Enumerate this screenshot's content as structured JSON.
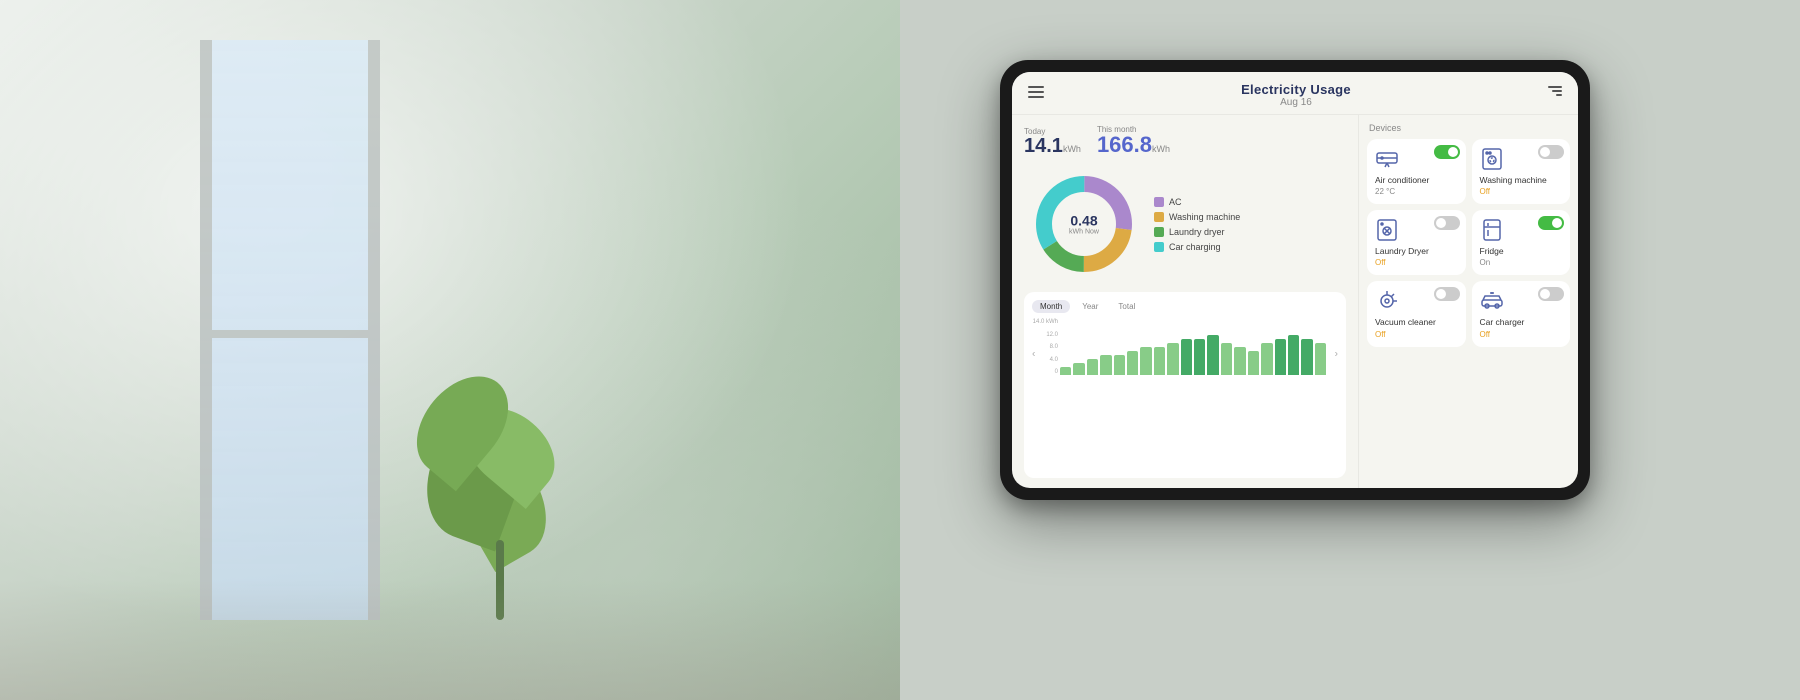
{
  "header": {
    "title": "Electricity Usage",
    "date": "Aug 16",
    "menu_icon": "menu",
    "filter_icon": "filter"
  },
  "stats": {
    "today_label": "Today",
    "today_value": "14.1",
    "today_unit": "kWh",
    "month_label": "This month",
    "month_value": "166.8",
    "month_unit": "kWh"
  },
  "donut": {
    "center_value": "0.48",
    "center_sub": "kWh Now",
    "segments": [
      {
        "label": "AC",
        "color": "#aa88cc",
        "pct": 27
      },
      {
        "label": "Washing machine",
        "color": "#ddaa44",
        "pct": 23
      },
      {
        "label": "Laundry dryer",
        "color": "#55aa55",
        "pct": 16
      },
      {
        "label": "Car charging",
        "color": "#44cccc",
        "pct": 34
      }
    ]
  },
  "bar_chart": {
    "tabs": [
      "Month",
      "Year",
      "Total"
    ],
    "active_tab": "Month",
    "y_labels": [
      "14.0 kWh",
      "12.0",
      "8.0",
      "4.0",
      "0"
    ],
    "bars": [
      2,
      3,
      4,
      5,
      5,
      6,
      7,
      7,
      8,
      9,
      9,
      10,
      8,
      7,
      6,
      8,
      9,
      10,
      9,
      8
    ],
    "max": 14
  },
  "devices": {
    "label": "Devices",
    "items": [
      {
        "id": "ac",
        "name": "Air conditioner",
        "status": "22 °C",
        "status_type": "on",
        "toggle": "on",
        "icon": "ac"
      },
      {
        "id": "washer",
        "name": "Washing machine",
        "status": "Off",
        "status_type": "off",
        "toggle": "off",
        "icon": "washer"
      },
      {
        "id": "dryer",
        "name": "Laundry Dryer",
        "status": "Off",
        "status_type": "off",
        "toggle": "off",
        "icon": "dryer"
      },
      {
        "id": "fridge",
        "name": "Fridge",
        "status": "On",
        "status_type": "on",
        "toggle": "on",
        "icon": "fridge"
      },
      {
        "id": "vacuum",
        "name": "Vacuum cleaner",
        "status": "Off",
        "status_type": "off",
        "toggle": "off",
        "icon": "vacuum"
      },
      {
        "id": "carcharger",
        "name": "Car charger",
        "status": "Off",
        "status_type": "off",
        "toggle": "off",
        "icon": "car"
      }
    ]
  }
}
